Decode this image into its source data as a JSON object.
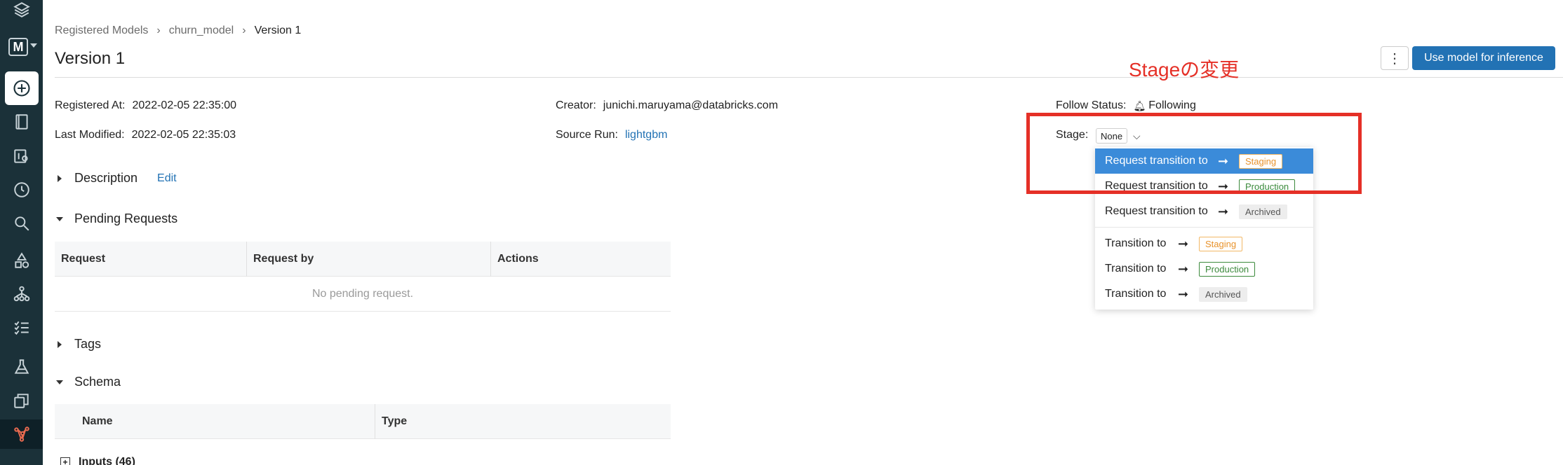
{
  "breadcrumb": {
    "registered_models": "Registered Models",
    "model": "churn_model",
    "current": "Version 1"
  },
  "page": {
    "title": "Version 1"
  },
  "header": {
    "kebab": "⋮",
    "primary_button": "Use model for inference"
  },
  "annotation": {
    "text": "Stageの変更",
    "color": "#e53027"
  },
  "meta": {
    "registered_at_label": "Registered At:",
    "registered_at_value": "2022-02-05 22:35:00",
    "last_modified_label": "Last Modified:",
    "last_modified_value": "2022-02-05 22:35:03",
    "creator_label": "Creator:",
    "creator_value": "junichi.maruyama@databricks.com",
    "source_run_label": "Source Run:",
    "source_run_value": "lightgbm",
    "follow_status_label": "Follow Status:",
    "follow_status_value": "Following",
    "stage_label": "Stage:",
    "stage_value": "None"
  },
  "sections": {
    "description": "Description",
    "edit": "Edit",
    "pending_requests": "Pending Requests",
    "tags": "Tags",
    "schema": "Schema"
  },
  "pending_table": {
    "columns": [
      "Request",
      "Request by",
      "Actions"
    ],
    "empty": "No pending request."
  },
  "schema_table": {
    "columns": [
      "Name",
      "Type"
    ],
    "inputs": "Inputs (46)"
  },
  "dropdown": {
    "items": [
      {
        "text": "Request transition to",
        "arrow": "➞",
        "tag": "Staging"
      },
      {
        "text": "Request transition to",
        "arrow": "➞",
        "tag": "Production"
      },
      {
        "text": "Request transition to",
        "arrow": "➞",
        "tag": "Archived"
      },
      {
        "text": "Transition to",
        "arrow": "➞",
        "tag": "Staging"
      },
      {
        "text": "Transition to",
        "arrow": "➞",
        "tag": "Production"
      },
      {
        "text": "Transition to",
        "arrow": "➞",
        "tag": "Archived"
      }
    ]
  },
  "colors": {
    "sidebar": "#1b3139",
    "primary": "#2272b4",
    "highlight": "#3b8bd9",
    "staging": "#e8922a",
    "production": "#3c8a3c"
  },
  "sidebar_icons": [
    "layers-icon",
    "workspace-m-icon",
    "create-plus-icon",
    "notebook-icon",
    "repos-icon",
    "recents-icon",
    "search-icon",
    "data-icon",
    "compute-icon",
    "jobs-icon",
    "experiments-icon",
    "feature-store-icon",
    "models-icon"
  ]
}
